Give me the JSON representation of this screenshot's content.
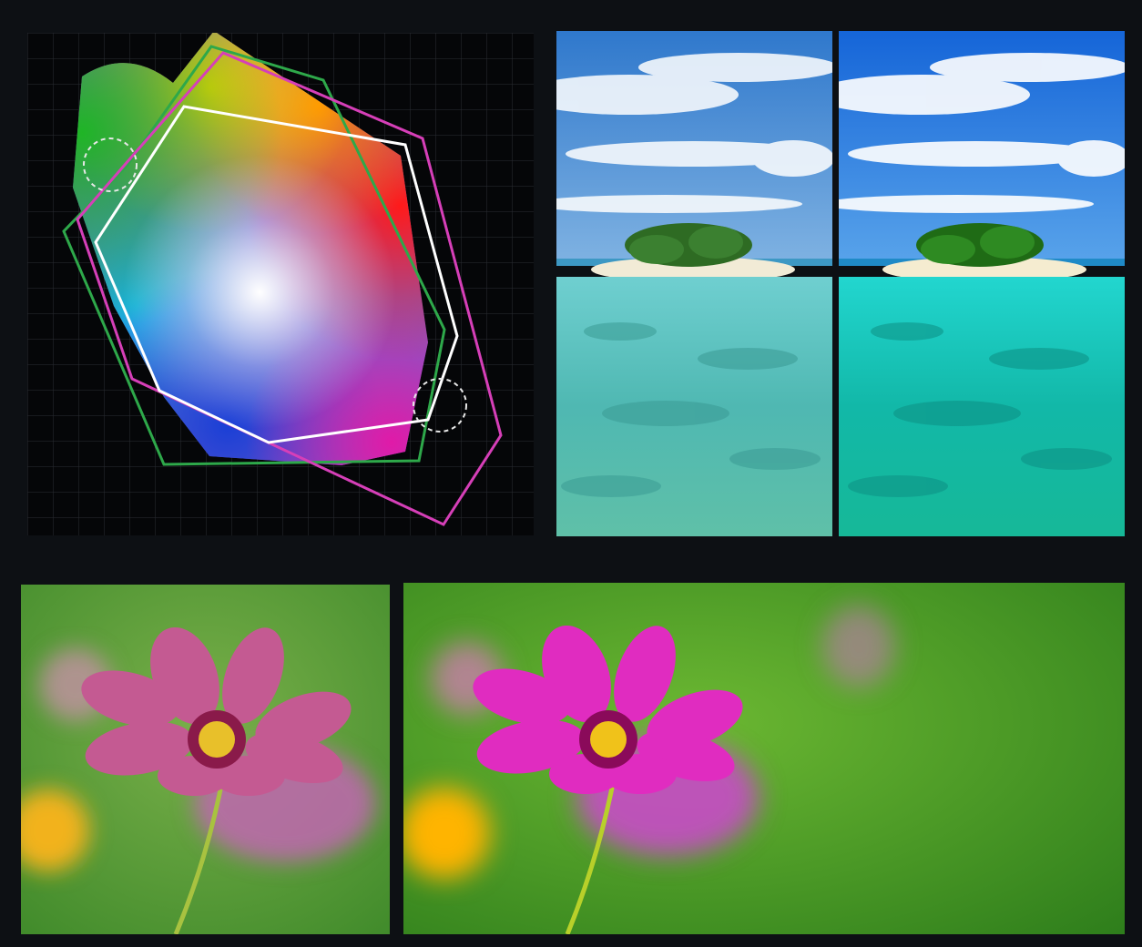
{
  "colors": {
    "background": "#0d1014",
    "srgb_outline": "#ffffff",
    "adobe_rgb_outline": "#2ea84a",
    "p3_outline": "#d63fb8",
    "highlight_circle": "#e8e8e8"
  },
  "panels": {
    "gamut": {
      "icon": "color-gamut-diagram"
    },
    "beach_before": {
      "icon": "island-photo-muted"
    },
    "beach_after": {
      "icon": "island-photo-vivid"
    },
    "flower_before": {
      "icon": "flower-photo-muted"
    },
    "flower_after": {
      "icon": "flower-photo-vivid"
    }
  }
}
